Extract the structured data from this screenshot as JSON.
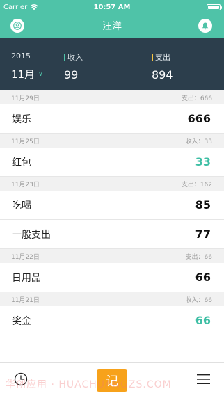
{
  "status_bar": {
    "carrier": "Carrier",
    "time": "10:57 AM"
  },
  "nav": {
    "title": "汪洋",
    "left_icon": "user-icon",
    "right_icon": "bell-icon"
  },
  "summary": {
    "year": "2015",
    "month": "11月",
    "income_label": "收入",
    "income_value": "99",
    "expense_label": "支出",
    "expense_value": "894",
    "income_color": "#4fc3a8",
    "expense_color": "#f5c342"
  },
  "groups": [
    {
      "date": "11月29日",
      "total": "支出：666",
      "entries": [
        {
          "category": "娱乐",
          "amount": "666",
          "type": "expense"
        }
      ]
    },
    {
      "date": "11月25日",
      "total": "收入：33",
      "entries": [
        {
          "category": "红包",
          "amount": "33",
          "type": "income"
        }
      ]
    },
    {
      "date": "11月23日",
      "total": "支出：162",
      "entries": [
        {
          "category": "吃喝",
          "amount": "85",
          "type": "expense"
        },
        {
          "category": "一般支出",
          "amount": "77",
          "type": "expense"
        }
      ]
    },
    {
      "date": "11月22日",
      "total": "支出：66",
      "entries": [
        {
          "category": "日用品",
          "amount": "66",
          "type": "expense"
        }
      ]
    },
    {
      "date": "11月21日",
      "total": "收入：66",
      "entries": [
        {
          "category": "奖金",
          "amount": "66",
          "type": "income"
        }
      ]
    }
  ],
  "tabbar": {
    "record_label": "记",
    "left_icon": "clock-icon",
    "right_icon": "menu-icon"
  },
  "watermark": "华创应用 · HUACHUANGZS.COM",
  "colors": {
    "accent": "#4fc3a8",
    "header_dark": "#2c3e4c",
    "record_button": "#f7a21b",
    "income_amount": "#3fbfa5"
  }
}
